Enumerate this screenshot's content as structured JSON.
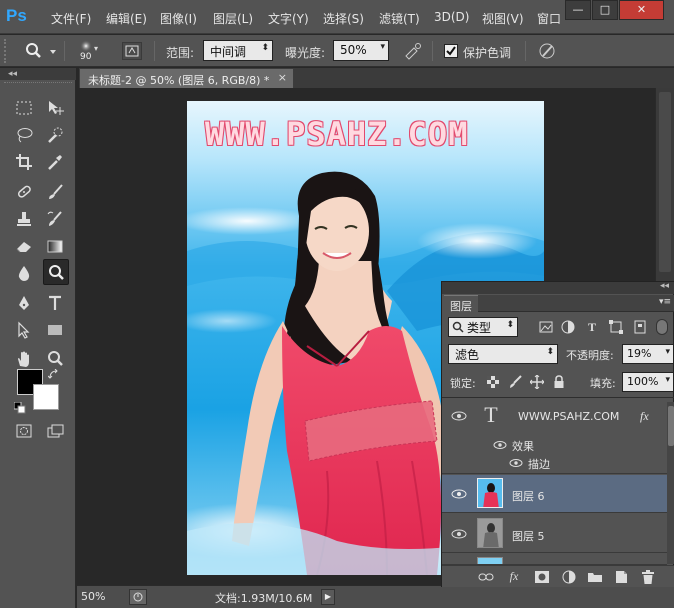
{
  "app": {
    "logo": "Ps"
  },
  "menu": [
    "文件(F)",
    "编辑(E)",
    "图像(I)",
    "图层(L)",
    "文字(Y)",
    "选择(S)",
    "滤镜(T)",
    "3D(D)",
    "视图(V)",
    "窗口"
  ],
  "window_controls": {
    "minimize": "—",
    "restore": "□",
    "close": "✕"
  },
  "options": {
    "brush_size": "90",
    "range_label": "范围:",
    "range_value": "中间调",
    "exposure_label": "曝光度:",
    "exposure_value": "50%",
    "protect_tones_label": "保护色调",
    "protect_tones_checked": true
  },
  "tools_header": "◂◂",
  "document": {
    "tab_title": "未标题-2 @ 50% (图层 6, RGB/8) *",
    "tab_close": "×",
    "watermark": "WWW.PSAHZ.COM"
  },
  "status": {
    "zoom": "50%",
    "doc_info": "文档:1.93M/10.6M",
    "arrow": "▶"
  },
  "layers_panel": {
    "tab_label": "图层",
    "menu_icon": "▾≡",
    "collapse_icon": "◂◂",
    "filter_kind": "类型",
    "blend_mode": "滤色",
    "opacity_label": "不透明度:",
    "opacity_value": "19%",
    "lock_label": "锁定:",
    "fill_label": "填充:",
    "fill_value": "100%",
    "layers": [
      {
        "type": "text",
        "name": "WWW.PSAHZ.COM",
        "fx": "fx",
        "effects_label": "效果",
        "effect_items": [
          "描边"
        ]
      },
      {
        "type": "image",
        "name": "图层 6",
        "selected": true
      },
      {
        "type": "image",
        "name": "图层 5",
        "selected": false
      }
    ]
  },
  "colors": {
    "ui_dark": "#535353",
    "selected_layer": "#5b6b82",
    "foreground": "#000000",
    "background": "#ffffff",
    "ps_blue": "#31a8ff"
  }
}
